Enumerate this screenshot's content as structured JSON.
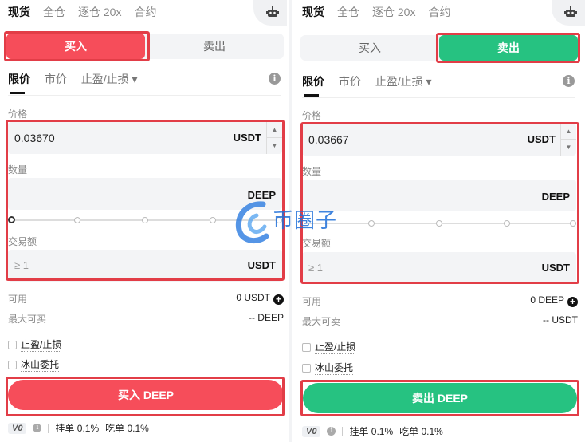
{
  "market_tabs": [
    "现货",
    "全仓",
    "逐仓 20x",
    "合约"
  ],
  "buy_label": "买入",
  "sell_label": "卖出",
  "order_types": [
    "限价",
    "市价",
    "止盈/止损 ▾"
  ],
  "price_label": "价格",
  "quantity_label": "数量",
  "amount_label": "交易额",
  "quote_unit": "USDT",
  "base_unit": "DEEP",
  "amount_placeholder": "≥ 1",
  "available_label": "可用",
  "max_label_buy": "最大可买",
  "max_label_sell": "最大可卖",
  "tp_sl_label": "止盈/止损",
  "iceberg_label": "冰山委托",
  "vip_level": "V0",
  "maker_fee": "挂单 0.1%",
  "taker_fee": "吃单 0.1%",
  "watermark_text": "币圈子",
  "colors": {
    "buy": "#f64d5a",
    "sell": "#26c281",
    "highlight": "#e23d47"
  },
  "left": {
    "price_value": "0.03670",
    "available_value": "0 USDT",
    "max_value": "-- DEEP",
    "submit_label": "买入 DEEP"
  },
  "right": {
    "price_value": "0.03667",
    "available_value": "0 DEEP",
    "max_value": "-- USDT",
    "submit_label": "卖出 DEEP"
  }
}
